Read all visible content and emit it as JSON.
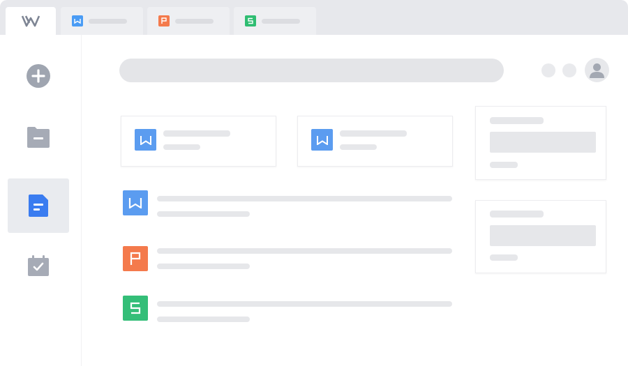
{
  "app": {
    "logo_icon": "wps-w-logo-icon"
  },
  "tabs": [
    {
      "icon": "writer-doc-icon",
      "color": "#4a9cf5"
    },
    {
      "icon": "presentation-doc-icon",
      "color": "#f47a4c"
    },
    {
      "icon": "spreadsheet-doc-icon",
      "color": "#2fbd72"
    }
  ],
  "sidebar": {
    "items": [
      {
        "icon": "new-plus-icon",
        "active": false
      },
      {
        "icon": "folder-icon",
        "active": false
      },
      {
        "icon": "document-icon",
        "active": true
      },
      {
        "icon": "calendar-check-icon",
        "active": false
      }
    ]
  },
  "colors": {
    "writer": "#5b9cf0",
    "presentation": "#f47a4c",
    "spreadsheet": "#34be78",
    "sidebar_icon": "#a2a7b2",
    "active_icon": "#3a7cf0"
  }
}
